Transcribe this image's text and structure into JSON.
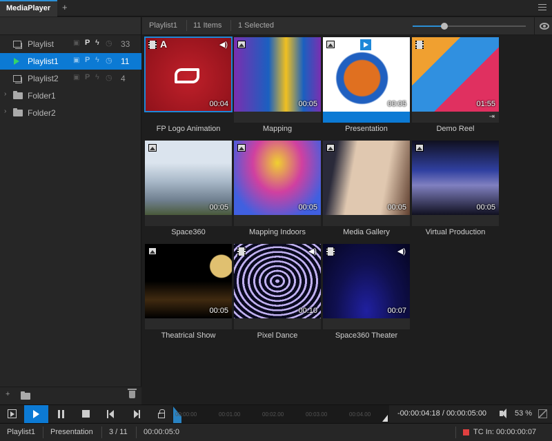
{
  "titlebar": {
    "tab_label": "MediaPlayer",
    "add_tab": "+"
  },
  "sidebar": {
    "items": [
      {
        "label": "Playlist",
        "count": "33",
        "type": "playlist"
      },
      {
        "label": "Playlist1",
        "count": "11",
        "type": "playlist-playing",
        "selected": true
      },
      {
        "label": "Playlist2",
        "count": "4",
        "type": "playlist"
      },
      {
        "label": "Folder1",
        "type": "folder"
      },
      {
        "label": "Folder2",
        "type": "folder"
      }
    ],
    "badge_p": "P",
    "footer_add": "+"
  },
  "toolbar": {
    "playlist_name": "Playlist1",
    "item_count": "11 Items",
    "selected_count": "1 Selected",
    "zoom_fraction": 0.28
  },
  "grid": {
    "items": [
      {
        "title": "FP Logo Animation",
        "duration": "00:04",
        "media": "video",
        "has_a": "A",
        "has_sound": true,
        "selected": true,
        "colors": [
          "#c0202a",
          "#8a1019"
        ]
      },
      {
        "title": "Mapping",
        "duration": "00:05",
        "media": "image",
        "colors": [
          "#7a2fb0",
          "#1a60c0",
          "#f0c020"
        ]
      },
      {
        "title": "Presentation",
        "duration": "00:05",
        "media": "image",
        "playing": true,
        "colors": [
          "#ffffff",
          "#e07020",
          "#2060c0"
        ]
      },
      {
        "title": "Demo Reel",
        "duration": "01:55",
        "media": "video",
        "end_marker": true,
        "colors": [
          "#f0a030",
          "#3090e0",
          "#e03060"
        ]
      },
      {
        "title": "Space360",
        "duration": "00:05",
        "media": "image",
        "colors": [
          "#dbe4ee",
          "#a8b8c8",
          "#708090"
        ]
      },
      {
        "title": "Mapping Indoors",
        "duration": "00:05",
        "media": "image",
        "colors": [
          "#d040a0",
          "#f0d030",
          "#4060e0"
        ]
      },
      {
        "title": "Media Gallery",
        "duration": "00:05",
        "media": "image",
        "colors": [
          "#e0c8b0",
          "#604030",
          "#2a2a3a"
        ]
      },
      {
        "title": "Virtual Production",
        "duration": "00:05",
        "media": "image",
        "colors": [
          "#3040a0",
          "#8080c0",
          "#101020"
        ]
      },
      {
        "title": "Theatrical Show",
        "duration": "00:05",
        "media": "image",
        "colors": [
          "#000000",
          "#402a10",
          "#e0c070"
        ]
      },
      {
        "title": "Pixel Dance",
        "duration": "00:10",
        "media": "video",
        "has_sound": true,
        "colors": [
          "#0a0a20",
          "#c0b0f0",
          "#4050c0"
        ]
      },
      {
        "title": "Space360 Theater",
        "duration": "00:07",
        "media": "video",
        "has_sound": true,
        "colors": [
          "#101050",
          "#2020a0",
          "#050520"
        ]
      }
    ]
  },
  "transport": {
    "ticks": [
      "00:00:00",
      "00:01.00",
      "00:02.00",
      "00:03.00",
      "00:04.00"
    ],
    "timecode": "-00:00:04:18 / 00:00:05:00",
    "volume": "53 %"
  },
  "status": {
    "playlist": "Playlist1",
    "item": "Presentation",
    "position": "3 / 11",
    "time": "00:00:05:0",
    "tc_label": "TC In:",
    "tc_value": "00:00:00:07"
  },
  "colors": {
    "accent": "#0c7ad4",
    "playing": "#35d46a",
    "rec": "#e04040"
  }
}
